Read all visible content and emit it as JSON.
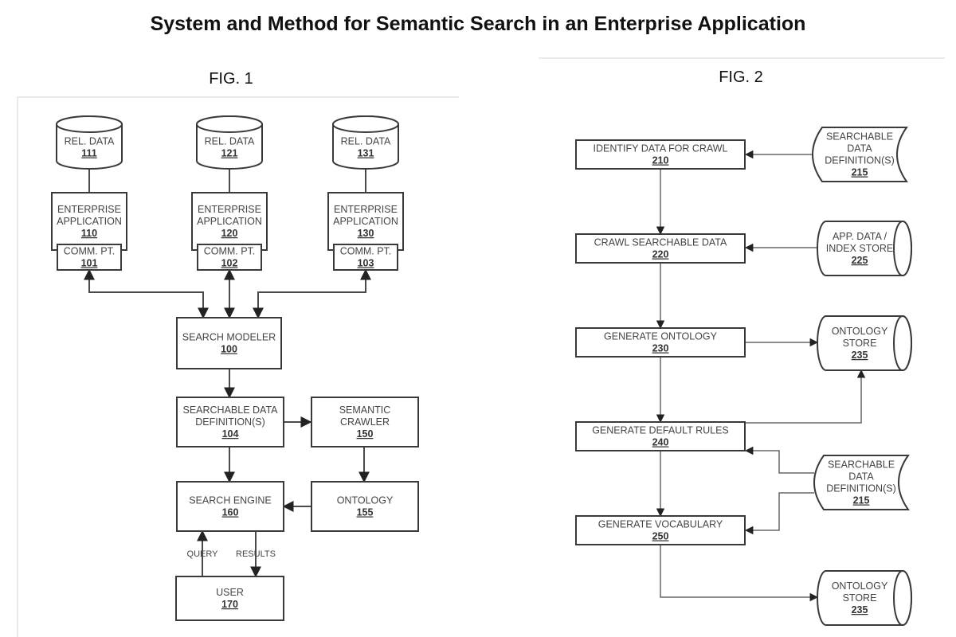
{
  "title": "System and Method for Semantic Search in an Enterprise Application",
  "fig1": {
    "label": "FIG. 1",
    "nodes": {
      "db111": {
        "lines": [
          "REL. DATA"
        ],
        "num": "111"
      },
      "db121": {
        "lines": [
          "REL. DATA"
        ],
        "num": "121"
      },
      "db131": {
        "lines": [
          "REL. DATA"
        ],
        "num": "131"
      },
      "app110": {
        "lines": [
          "ENTERPRISE",
          "APPLICATION"
        ],
        "num": "110"
      },
      "app120": {
        "lines": [
          "ENTERPRISE",
          "APPLICATION"
        ],
        "num": "120"
      },
      "app130": {
        "lines": [
          "ENTERPRISE",
          "APPLICATION"
        ],
        "num": "130"
      },
      "cp101": {
        "lines": [
          "COMM. PT."
        ],
        "num": "101"
      },
      "cp102": {
        "lines": [
          "COMM. PT."
        ],
        "num": "102"
      },
      "cp103": {
        "lines": [
          "COMM. PT."
        ],
        "num": "103"
      },
      "sm100": {
        "lines": [
          "SEARCH MODELER"
        ],
        "num": "100"
      },
      "sdd104": {
        "lines": [
          "SEARCHABLE DATA",
          "DEFINITION(S)"
        ],
        "num": "104"
      },
      "sc150": {
        "lines": [
          "SEMANTIC",
          "CRAWLER"
        ],
        "num": "150"
      },
      "se160": {
        "lines": [
          "SEARCH ENGINE"
        ],
        "num": "160"
      },
      "on155": {
        "lines": [
          "ONTOLOGY"
        ],
        "num": "155"
      },
      "us170": {
        "lines": [
          "USER"
        ],
        "num": "170"
      }
    },
    "edge_labels": {
      "query": "QUERY",
      "results": "RESULTS"
    }
  },
  "fig2": {
    "label": "FIG. 2",
    "steps": {
      "s210": {
        "lines": [
          "IDENTIFY DATA FOR CRAWL"
        ],
        "num": "210"
      },
      "s220": {
        "lines": [
          "CRAWL SEARCHABLE DATA"
        ],
        "num": "220"
      },
      "s230": {
        "lines": [
          "GENERATE ONTOLOGY"
        ],
        "num": "230"
      },
      "s240": {
        "lines": [
          "GENERATE DEFAULT RULES"
        ],
        "num": "240"
      },
      "s250": {
        "lines": [
          "GENERATE VOCABULARY"
        ],
        "num": "250"
      }
    },
    "stores": {
      "d215a": {
        "lines": [
          "SEARCHABLE",
          "DATA",
          "DEFINITION(S)"
        ],
        "num": "215"
      },
      "d225": {
        "lines": [
          "APP. DATA /",
          "INDEX STORE"
        ],
        "num": "225"
      },
      "d235a": {
        "lines": [
          "ONTOLOGY",
          "STORE"
        ],
        "num": "235"
      },
      "d215b": {
        "lines": [
          "SEARCHABLE",
          "DATA",
          "DEFINITION(S)"
        ],
        "num": "215"
      },
      "d235b": {
        "lines": [
          "ONTOLOGY",
          "STORE"
        ],
        "num": "235"
      }
    }
  }
}
